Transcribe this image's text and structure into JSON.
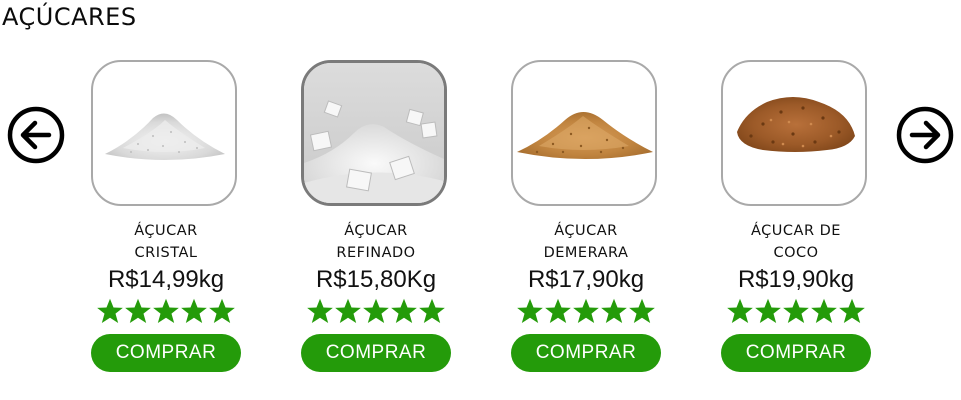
{
  "section": {
    "title": "AÇÚCARES"
  },
  "nav": {
    "prev_icon": "arrow-left-circle-icon",
    "next_icon": "arrow-right-circle-icon"
  },
  "colors": {
    "accent": "#249b0a",
    "star": "#249b0a",
    "frame": "#a9a9a9"
  },
  "products": [
    {
      "name_line1": "ÁÇUCAR",
      "name_line2": "CRISTAL",
      "price": "R$14,99kg",
      "rating": 5,
      "button": "COMPRAR",
      "image": "white-crystal-sugar-pile"
    },
    {
      "name_line1": "ÁÇUCAR",
      "name_line2": "REFINADO",
      "price": "R$15,80Kg",
      "rating": 5,
      "button": "COMPRAR",
      "image": "refined-sugar-with-cubes"
    },
    {
      "name_line1": "ÁÇUCAR",
      "name_line2": "DEMERARA",
      "price": "R$17,90kg",
      "rating": 5,
      "button": "COMPRAR",
      "image": "demerara-sugar-pile"
    },
    {
      "name_line1": "ÁÇUCAR DE",
      "name_line2": "COCO",
      "price": "R$19,90kg",
      "rating": 5,
      "button": "COMPRAR",
      "image": "coconut-sugar-pile"
    }
  ]
}
